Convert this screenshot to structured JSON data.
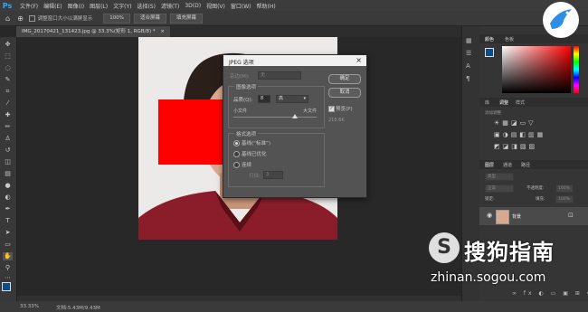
{
  "menubar": {
    "logo": "Ps",
    "items": [
      "文件(F)",
      "编辑(E)",
      "图像(I)",
      "图层(L)",
      "文字(Y)",
      "选择(S)",
      "滤镜(T)",
      "3D(D)",
      "视图(V)",
      "窗口(W)",
      "帮助(H)"
    ]
  },
  "options": {
    "resize_checkbox_label": "调整窗口大小以满屏显示",
    "zoom": "100%",
    "fit_screen": "适合屏幕",
    "fill_screen": "填充屏幕"
  },
  "document": {
    "tab_title": "IMG_20170421_131423.jpg @ 33.3%(矩形 1, RGB/8) *",
    "close": "×"
  },
  "dialog": {
    "title": "JPEG 选项",
    "close": "×",
    "matte_label": "杂边(M):",
    "matte_value": "无",
    "image_options_title": "图像选项",
    "quality_label": "品质(Q):",
    "quality_value": "8",
    "quality_select": "高",
    "small_file": "小文件",
    "large_file": "大文件",
    "format_title": "格式选项",
    "format_options": [
      "基线(“标准”)",
      "基线已优化",
      "连续"
    ],
    "selected_format": 0,
    "scan_label": "扫描:",
    "scan_value": "3",
    "ok": "确定",
    "cancel": "取消",
    "preview_label": "预览(P)",
    "file_size": "215.6K"
  },
  "panels": {
    "color_tabs": [
      "颜色",
      "色板"
    ],
    "adjust_tabs": [
      "库",
      "调整",
      "样式"
    ],
    "adjust_hint": "添加调整",
    "layers_tabs": [
      "图层",
      "通道",
      "路径"
    ],
    "kind": "类型",
    "blend_mode": "正常",
    "opacity_label": "不透明度:",
    "opacity_value": "100%",
    "lock_label": "锁定:",
    "fill_label": "填充:",
    "fill_value": "100%",
    "layer_name": "背景"
  },
  "status": {
    "zoom": "33.33%",
    "doc_info": "文档:5.43M/9.43M"
  },
  "watermark": {
    "logo": "S",
    "name": "搜狗指南",
    "url": "zhinan.sogou.com"
  },
  "colors": {
    "accent": "#31a8ff",
    "red_rect": "#ff0000",
    "shirt": "#8b1d2a",
    "fg_swatch": "#0a4d8c"
  }
}
